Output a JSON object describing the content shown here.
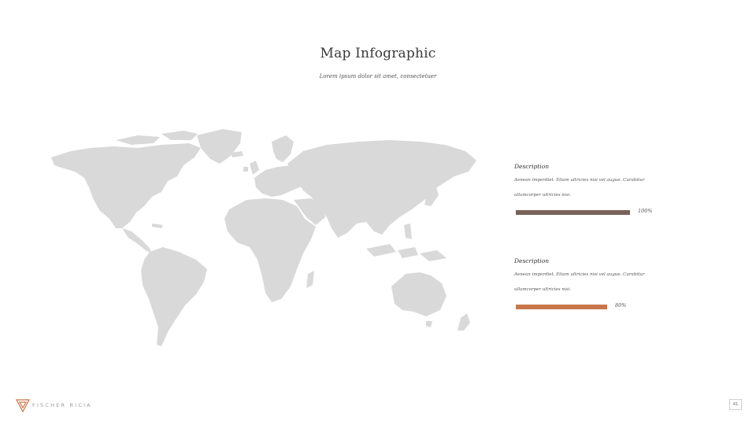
{
  "slide": {
    "title": "Map Infographic",
    "subtitle": "Lorem ipsum dolor sit amet, consectetuer"
  },
  "map": {
    "icon": "world-map",
    "color": "#d9d9d9"
  },
  "items": [
    {
      "heading": "Description",
      "text": "Aenean imperdiet. Etiam ultricies nisi vel augue. Curabitur ullamcorper ultricies nisi.",
      "value": 1.0,
      "percent_label": "100%",
      "color": "#7a6258"
    },
    {
      "heading": "Description",
      "text": "Aenean imperdiet. Etiam ultricies nisi vel augue. Curabitur ullamcorper ultricies nisi.",
      "value": 0.8,
      "percent_label": "80%",
      "color": "#c8764a"
    }
  ],
  "footer": {
    "brand": "FISCHER RICIA",
    "page_number": "41",
    "logo_icon": "triangle-logo",
    "logo_color": "#c8764a"
  }
}
